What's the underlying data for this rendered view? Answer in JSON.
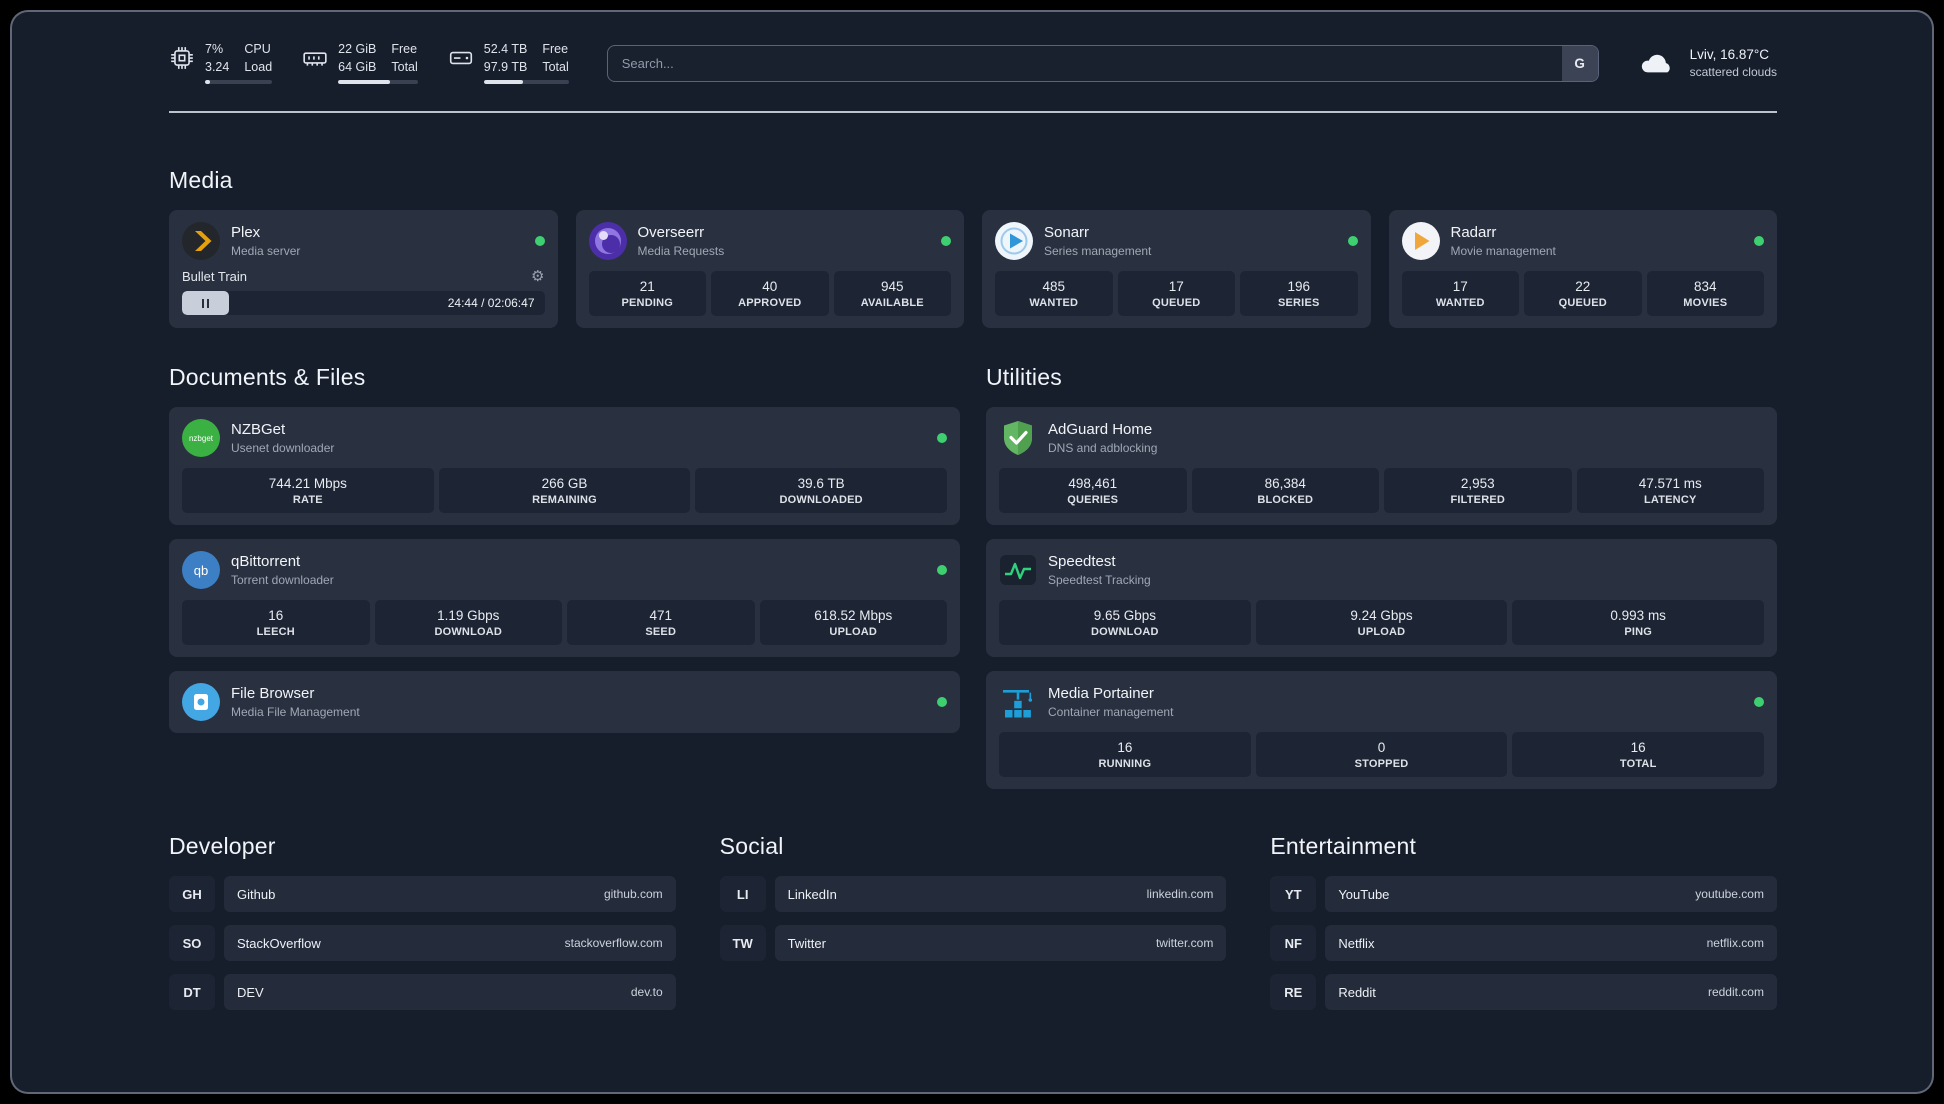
{
  "colors": {
    "status_online": "#3ecf70",
    "progress_fill": "#dfe4ec",
    "divider": "#dbe1e9"
  },
  "topbar": {
    "cpu": {
      "values": [
        "7%",
        "3.24"
      ],
      "labels": [
        "CPU",
        "Load"
      ],
      "percent": 7
    },
    "memory": {
      "values": [
        "22 GiB",
        "64 GiB"
      ],
      "labels": [
        "Free",
        "Total"
      ],
      "percent": 65
    },
    "disk": {
      "values": [
        "52.4 TB",
        "97.9 TB"
      ],
      "labels": [
        "Free",
        "Total"
      ],
      "percent": 46
    },
    "search": {
      "placeholder": "Search...",
      "button_label": "G"
    },
    "weather": {
      "location": "Lviv, 16.87°C",
      "condition": "scattered clouds"
    }
  },
  "media": {
    "title": "Media",
    "cards": [
      {
        "name": "Plex",
        "subtitle": "Media server",
        "online": true,
        "player": {
          "track": "Bullet Train",
          "time": "24:44 / 02:06:47",
          "progress": 13
        }
      },
      {
        "name": "Overseerr",
        "subtitle": "Media Requests",
        "online": true,
        "stats": [
          {
            "value": "21",
            "label": "PENDING"
          },
          {
            "value": "40",
            "label": "APPROVED"
          },
          {
            "value": "945",
            "label": "AVAILABLE"
          }
        ]
      },
      {
        "name": "Sonarr",
        "subtitle": "Series management",
        "online": true,
        "stats": [
          {
            "value": "485",
            "label": "WANTED"
          },
          {
            "value": "17",
            "label": "QUEUED"
          },
          {
            "value": "196",
            "label": "SERIES"
          }
        ]
      },
      {
        "name": "Radarr",
        "subtitle": "Movie management",
        "online": true,
        "stats": [
          {
            "value": "17",
            "label": "WANTED"
          },
          {
            "value": "22",
            "label": "QUEUED"
          },
          {
            "value": "834",
            "label": "MOVIES"
          }
        ]
      }
    ]
  },
  "documents": {
    "title": "Documents & Files",
    "cards": [
      {
        "name": "NZBGet",
        "subtitle": "Usenet downloader",
        "online": true,
        "stats": [
          {
            "value": "744.21 Mbps",
            "label": "RATE"
          },
          {
            "value": "266 GB",
            "label": "REMAINING"
          },
          {
            "value": "39.6 TB",
            "label": "DOWNLOADED"
          }
        ]
      },
      {
        "name": "qBittorrent",
        "subtitle": "Torrent downloader",
        "online": true,
        "stats": [
          {
            "value": "16",
            "label": "LEECH"
          },
          {
            "value": "1.19 Gbps",
            "label": "DOWNLOAD"
          },
          {
            "value": "471",
            "label": "SEED"
          },
          {
            "value": "618.52 Mbps",
            "label": "UPLOAD"
          }
        ]
      },
      {
        "name": "File Browser",
        "subtitle": "Media File Management",
        "online": true
      }
    ]
  },
  "utilities": {
    "title": "Utilities",
    "cards": [
      {
        "name": "AdGuard Home",
        "subtitle": "DNS and adblocking",
        "online": false,
        "stats": [
          {
            "value": "498,461",
            "label": "QUERIES"
          },
          {
            "value": "86,384",
            "label": "BLOCKED"
          },
          {
            "value": "2,953",
            "label": "FILTERED"
          },
          {
            "value": "47.571 ms",
            "label": "LATENCY"
          }
        ]
      },
      {
        "name": "Speedtest",
        "subtitle": "Speedtest Tracking",
        "online": false,
        "stats": [
          {
            "value": "9.65 Gbps",
            "label": "DOWNLOAD"
          },
          {
            "value": "9.24 Gbps",
            "label": "UPLOAD"
          },
          {
            "value": "0.993 ms",
            "label": "PING"
          }
        ]
      },
      {
        "name": "Media Portainer",
        "subtitle": "Container management",
        "online": true,
        "stats": [
          {
            "value": "16",
            "label": "RUNNING"
          },
          {
            "value": "0",
            "label": "STOPPED"
          },
          {
            "value": "16",
            "label": "TOTAL"
          }
        ]
      }
    ]
  },
  "links": {
    "developer": {
      "title": "Developer",
      "items": [
        {
          "abbr": "GH",
          "name": "Github",
          "domain": "github.com"
        },
        {
          "abbr": "SO",
          "name": "StackOverflow",
          "domain": "stackoverflow.com"
        },
        {
          "abbr": "DT",
          "name": "DEV",
          "domain": "dev.to"
        }
      ]
    },
    "social": {
      "title": "Social",
      "items": [
        {
          "abbr": "LI",
          "name": "LinkedIn",
          "domain": "linkedin.com"
        },
        {
          "abbr": "TW",
          "name": "Twitter",
          "domain": "twitter.com"
        }
      ]
    },
    "entertainment": {
      "title": "Entertainment",
      "items": [
        {
          "abbr": "YT",
          "name": "YouTube",
          "domain": "youtube.com"
        },
        {
          "abbr": "NF",
          "name": "Netflix",
          "domain": "netflix.com"
        },
        {
          "abbr": "RE",
          "name": "Reddit",
          "domain": "reddit.com"
        }
      ]
    }
  }
}
